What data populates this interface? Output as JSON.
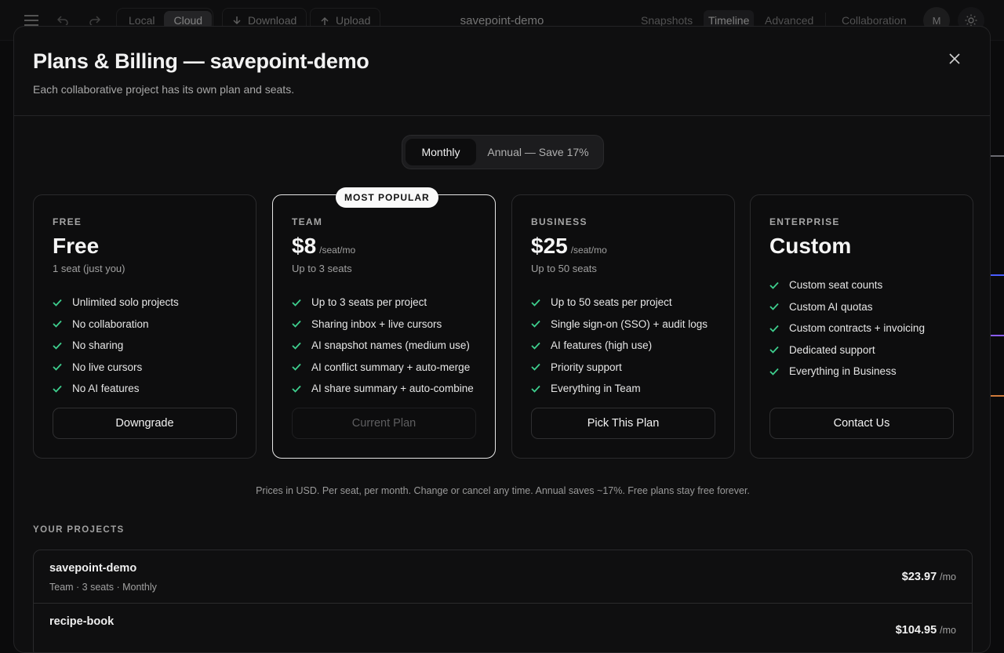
{
  "topbar": {
    "location_options": [
      "Local",
      "Cloud"
    ],
    "active_location": "Cloud",
    "download_label": "Download",
    "upload_label": "Upload",
    "project_title": "savepoint-demo",
    "view_tabs": [
      "Snapshots",
      "Timeline",
      "Advanced"
    ],
    "active_view": "Timeline",
    "collaboration_label": "Collaboration",
    "avatar_initial": "M"
  },
  "modal": {
    "title": "Plans & Billing — savepoint-demo",
    "subtitle": "Each collaborative project has its own plan and seats.",
    "billing_toggle": {
      "monthly_label": "Monthly",
      "annual_label": "Annual — Save 17%",
      "selected": "Monthly"
    },
    "plans": [
      {
        "tier": "FREE",
        "price": "Free",
        "unit": "",
        "seats": "1 seat (just you)",
        "features": [
          "Unlimited solo projects",
          "No collaboration",
          "No sharing",
          "No live cursors",
          "No AI features"
        ],
        "button_label": "Downgrade"
      },
      {
        "tier": "TEAM",
        "badge": "MOST POPULAR",
        "price": "$8",
        "unit": "/seat/mo",
        "seats": "Up to 3 seats",
        "features": [
          "Up to 3 seats per project",
          "Sharing inbox + live cursors",
          "AI snapshot names (medium use)",
          "AI conflict summary + auto-merge",
          "AI share summary + auto-combine"
        ],
        "button_label": "Current Plan"
      },
      {
        "tier": "BUSINESS",
        "price": "$25",
        "unit": "/seat/mo",
        "seats": "Up to 50 seats",
        "features": [
          "Up to 50 seats per project",
          "Single sign-on (SSO) + audit logs",
          "AI features (high use)",
          "Priority support",
          "Everything in Team"
        ],
        "button_label": "Pick This Plan"
      },
      {
        "tier": "ENTERPRISE",
        "price": "Custom",
        "unit": "",
        "seats": "",
        "features": [
          "Custom seat counts",
          "Custom AI quotas",
          "Custom contracts + invoicing",
          "Dedicated support",
          "Everything in Business"
        ],
        "button_label": "Contact Us"
      }
    ],
    "footnote": "Prices in USD. Per seat, per month. Change or cancel any time. Annual saves ~17%. Free plans stay free forever.",
    "projects_label": "YOUR PROJECTS",
    "projects": [
      {
        "name": "savepoint-demo",
        "meta": "Team · 3 seats · Monthly",
        "cost": "$23.97",
        "unit": "/mo"
      },
      {
        "name": "recipe-book",
        "meta": "",
        "cost": "$104.95",
        "unit": "/mo"
      }
    ]
  },
  "colors": {
    "accent_check": "#3ecf8e",
    "background": "#0f0f10",
    "featured_border": "#e6e6e6"
  }
}
